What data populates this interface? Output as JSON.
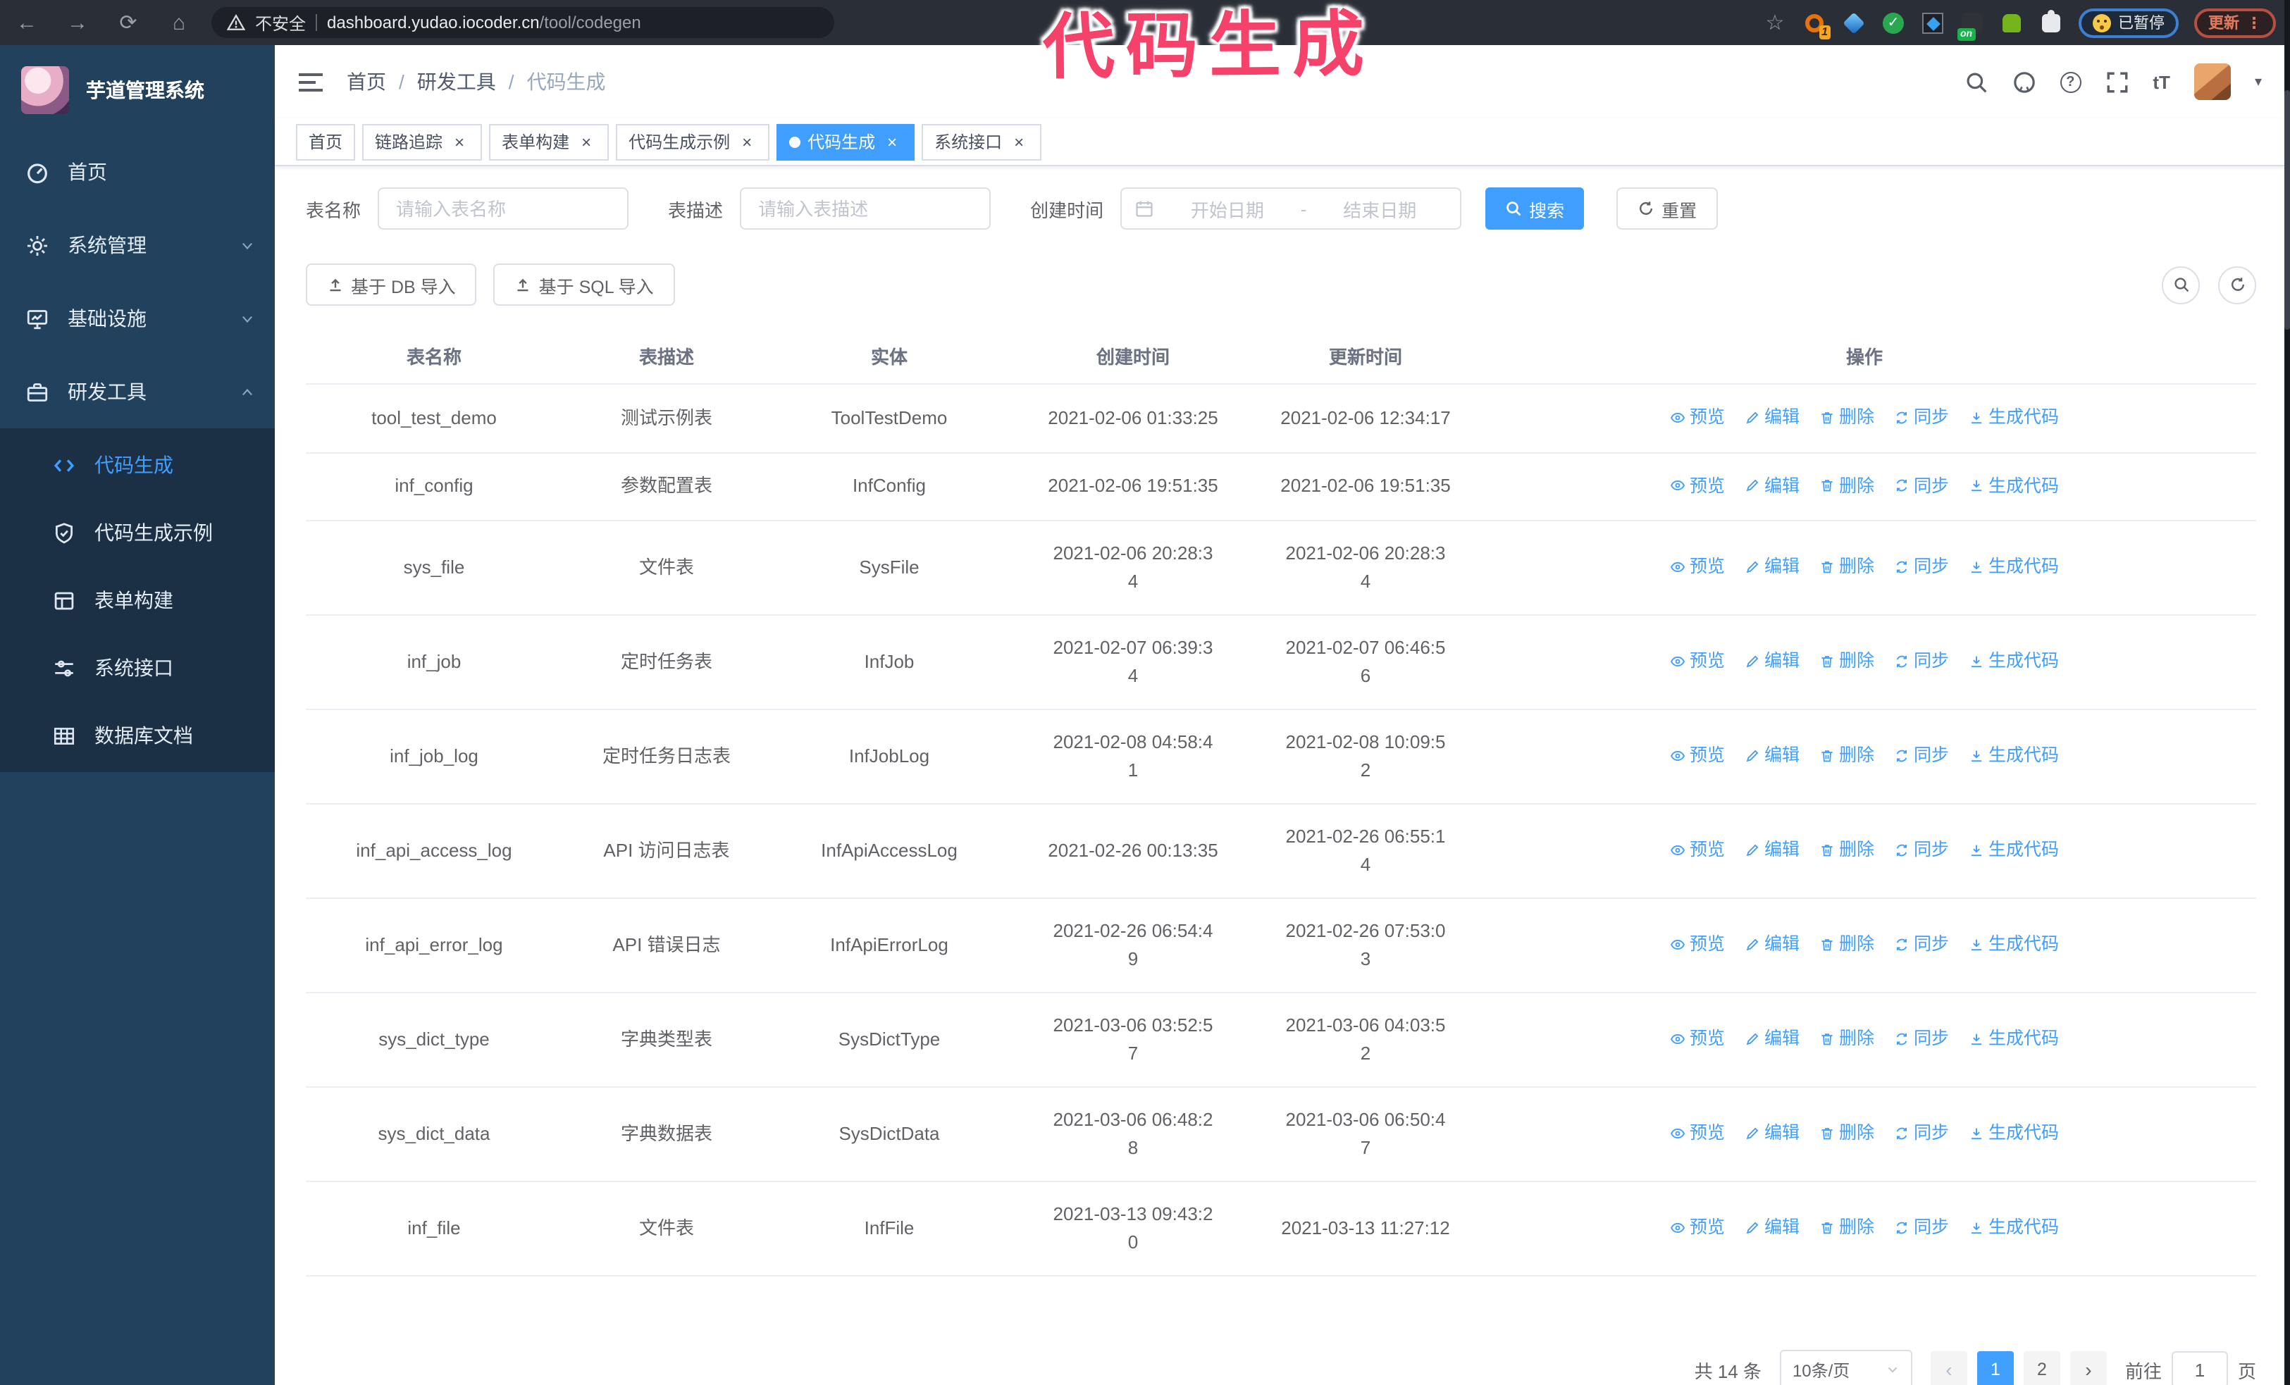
{
  "colors": {
    "accent": "#409eff",
    "annotation_pink": "#f4426b",
    "sidebar_bg": "#22415c",
    "submenu_bg": "#1b3044"
  },
  "annotation": {
    "text": "代码生成"
  },
  "browser": {
    "security_label": "不安全",
    "url_host": "dashboard.yudao.iocoder.cn",
    "url_path": "/tool/codegen",
    "nav_icons": [
      "back-icon",
      "forward-icon",
      "reload-icon",
      "home-icon"
    ],
    "extensions": [
      {
        "icon": "bookmark-star-icon"
      },
      {
        "icon": "orange-ring-extension-icon",
        "badge": "1"
      },
      {
        "icon": "blue-gem-extension-icon"
      },
      {
        "icon": "green-check-extension-icon",
        "glyph": "✓"
      },
      {
        "icon": "grid-extension-icon"
      },
      {
        "icon": "dark-on-extension-icon",
        "badge": "on"
      },
      {
        "icon": "green-bot-extension-icon"
      },
      {
        "icon": "puzzle-extension-icon"
      }
    ],
    "paused_badge": "已暂停",
    "update_button": "更新",
    "menu_dots": "⋮"
  },
  "sidebar": {
    "title": "芋道管理系统",
    "items": [
      {
        "label": "首页",
        "icon": "dashboard-icon"
      },
      {
        "label": "系统管理",
        "icon": "gear-icon",
        "chevron": "down"
      },
      {
        "label": "基础设施",
        "icon": "infrastructure-icon",
        "chevron": "down"
      },
      {
        "label": "研发工具",
        "icon": "tools-icon",
        "chevron": "up"
      }
    ],
    "submenu": [
      {
        "label": "代码生成",
        "icon": "code-icon",
        "active": true
      },
      {
        "label": "代码生成示例",
        "icon": "example-icon"
      },
      {
        "label": "表单构建",
        "icon": "form-icon"
      },
      {
        "label": "系统接口",
        "icon": "api-icon"
      },
      {
        "label": "数据库文档",
        "icon": "database-icon"
      }
    ]
  },
  "header": {
    "breadcrumb": [
      "首页",
      "研发工具",
      "代码生成"
    ],
    "separator": "/",
    "right_icons": [
      "search-icon",
      "github-icon",
      "help-icon",
      "fullscreen-icon",
      "textsize-icon"
    ],
    "textsize_glyph": "tT",
    "caret_glyph": "▾"
  },
  "tabs": {
    "close_glyph": "×",
    "items": [
      {
        "label": "首页",
        "closable": false,
        "active": false
      },
      {
        "label": "链路追踪",
        "closable": true,
        "active": false
      },
      {
        "label": "表单构建",
        "closable": true,
        "active": false
      },
      {
        "label": "代码生成示例",
        "closable": true,
        "active": false
      },
      {
        "label": "代码生成",
        "closable": true,
        "active": true
      },
      {
        "label": "系统接口",
        "closable": true,
        "active": false
      }
    ]
  },
  "filters": {
    "name_label": "表名称",
    "name_placeholder": "请输入表名称",
    "desc_label": "表描述",
    "desc_placeholder": "请输入表描述",
    "time_label": "创建时间",
    "start_placeholder": "开始日期",
    "range_separator": "-",
    "end_placeholder": "结束日期",
    "search_label": "搜索",
    "reset_label": "重置"
  },
  "toolbar": {
    "import_db_label": "基于 DB 导入",
    "import_sql_label": "基于 SQL 导入"
  },
  "table": {
    "columns": [
      "表名称",
      "表描述",
      "实体",
      "创建时间",
      "更新时间",
      "操作"
    ],
    "actions": [
      {
        "label": "预览",
        "icon": "eye-icon"
      },
      {
        "label": "编辑",
        "icon": "edit-icon"
      },
      {
        "label": "删除",
        "icon": "delete-icon"
      },
      {
        "label": "同步",
        "icon": "sync-icon"
      },
      {
        "label": "生成代码",
        "icon": "generate-icon"
      }
    ],
    "rows": [
      {
        "name": "tool_test_demo",
        "desc": "测试示例表",
        "entity": "ToolTestDemo",
        "created": "2021-02-06 01:33:25",
        "updated": "2021-02-06 12:34:17"
      },
      {
        "name": "inf_config",
        "desc": "参数配置表",
        "entity": "InfConfig",
        "created": "2021-02-06 19:51:35",
        "updated": "2021-02-06 19:51:35"
      },
      {
        "name": "sys_file",
        "desc": "文件表",
        "entity": "SysFile",
        "created": "2021-02-06 20:28:3\n4",
        "updated": "2021-02-06 20:28:3\n4"
      },
      {
        "name": "inf_job",
        "desc": "定时任务表",
        "entity": "InfJob",
        "created": "2021-02-07 06:39:3\n4",
        "updated": "2021-02-07 06:46:5\n6"
      },
      {
        "name": "inf_job_log",
        "desc": "定时任务日志表",
        "entity": "InfJobLog",
        "created": "2021-02-08 04:58:4\n1",
        "updated": "2021-02-08 10:09:5\n2"
      },
      {
        "name": "inf_api_access_log",
        "desc": "API 访问日志表",
        "entity": "InfApiAccessLog",
        "created": "2021-02-26 00:13:35",
        "updated": "2021-02-26 06:55:1\n4"
      },
      {
        "name": "inf_api_error_log",
        "desc": "API 错误日志",
        "entity": "InfApiErrorLog",
        "created": "2021-02-26 06:54:4\n9",
        "updated": "2021-02-26 07:53:0\n3"
      },
      {
        "name": "sys_dict_type",
        "desc": "字典类型表",
        "entity": "SysDictType",
        "created": "2021-03-06 03:52:5\n7",
        "updated": "2021-03-06 04:03:5\n2"
      },
      {
        "name": "sys_dict_data",
        "desc": "字典数据表",
        "entity": "SysDictData",
        "created": "2021-03-06 06:48:2\n8",
        "updated": "2021-03-06 06:50:4\n7"
      },
      {
        "name": "inf_file",
        "desc": "文件表",
        "entity": "InfFile",
        "created": "2021-03-13 09:43:2\n0",
        "updated": "2021-03-13 11:27:12"
      }
    ]
  },
  "pagination": {
    "total_label": "共 14 条",
    "page_size_label": "10条/页",
    "prev_glyph": "‹",
    "next_glyph": "›",
    "pages": [
      "1",
      "2"
    ],
    "active_page": "1",
    "goto_label": "前往",
    "goto_value": "1",
    "goto_suffix": "页"
  }
}
